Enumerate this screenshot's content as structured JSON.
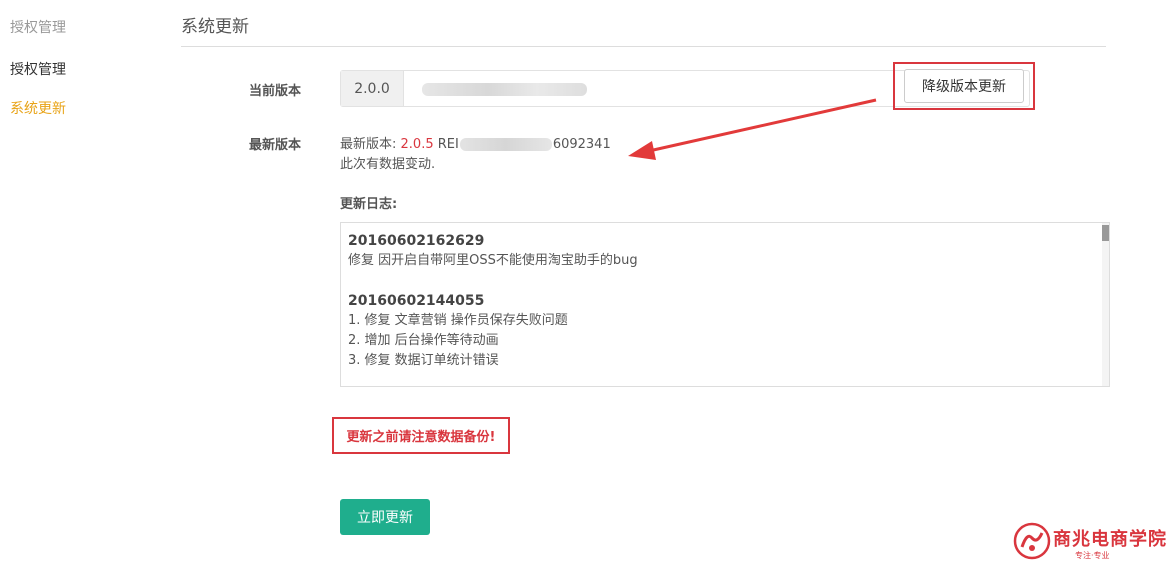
{
  "sidebar": {
    "heading": "授权管理",
    "items": [
      {
        "label": "授权管理",
        "active": false
      },
      {
        "label": "系统更新",
        "active": true
      }
    ]
  },
  "page": {
    "title": "系统更新"
  },
  "current_version": {
    "label": "当前版本",
    "value": "2.0.0",
    "downgrade_label": "降级版本更新"
  },
  "latest_version": {
    "label": "最新版本",
    "prefix": "最新版本: ",
    "version": "2.0.5",
    "release_prefix": " REI",
    "release_suffix": "6092341",
    "note": "此次有数据变动."
  },
  "changelog": {
    "heading": "更新日志:",
    "entries": [
      {
        "date": "20160602162629",
        "lines": [
          "修复 因开启自带阿里OSS不能使用淘宝助手的bug"
        ]
      },
      {
        "date": "20160602144055",
        "lines": [
          "1. 修复 文章营销 操作员保存失败问题",
          "2. 增加 后台操作等待动画",
          "3. 修复 数据订单统计错误"
        ]
      }
    ]
  },
  "warning": "更新之前请注意数据备份!",
  "update_button": "立即更新",
  "logo": {
    "text": "商兆电商学院",
    "subtitle": "专注·专业"
  },
  "colors": {
    "accent_orange": "#e8a317",
    "highlight_red": "#d9363e",
    "primary_green": "#1fae8d"
  }
}
